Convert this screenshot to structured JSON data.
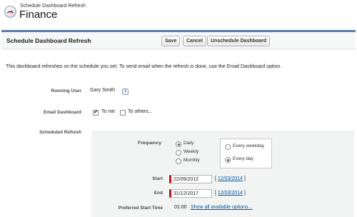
{
  "header": {
    "subtitle": "Schedule Dashboard Refresh",
    "title": "Finance"
  },
  "panel": {
    "title": "Schedule Dashboard Refresh",
    "buttons": {
      "save": "Save",
      "cancel": "Cancel",
      "unschedule": "Unschedule Dashboard"
    }
  },
  "description": "This dashboard refreshes on the schedule you set. To send email when the refresh is done, use the Email Dashboard option.",
  "running_user": {
    "label": "Running User",
    "value": "Gary Smith",
    "info_icon": "i"
  },
  "email_dashboard": {
    "label": "Email Dashboard",
    "to_me": "To me",
    "to_me_checked": true,
    "to_others": "To others...",
    "to_others_checked": false
  },
  "scheduled_refresh": {
    "label": "Scheduled Refresh",
    "frequency_label": "Frequency",
    "frequency_options": [
      "Daily",
      "Weekly",
      "Monthly"
    ],
    "frequency_selected": "Daily",
    "daily_options": [
      "Every weekday",
      "Every day"
    ],
    "daily_selected": "Every day",
    "start_label": "Start",
    "start_value": "22/09/2012",
    "start_today": "12/03/2014",
    "end_label": "End",
    "end_value": "31/12/2017",
    "end_today": "12/03/2014",
    "preferred_time_label": "Preferred Start Time",
    "preferred_time_value": "01:00",
    "show_all_link": "Show all available options..."
  },
  "colors": {
    "panel_border": "#5a7ea8",
    "link": "#015ba7",
    "required": "#c0171f"
  }
}
